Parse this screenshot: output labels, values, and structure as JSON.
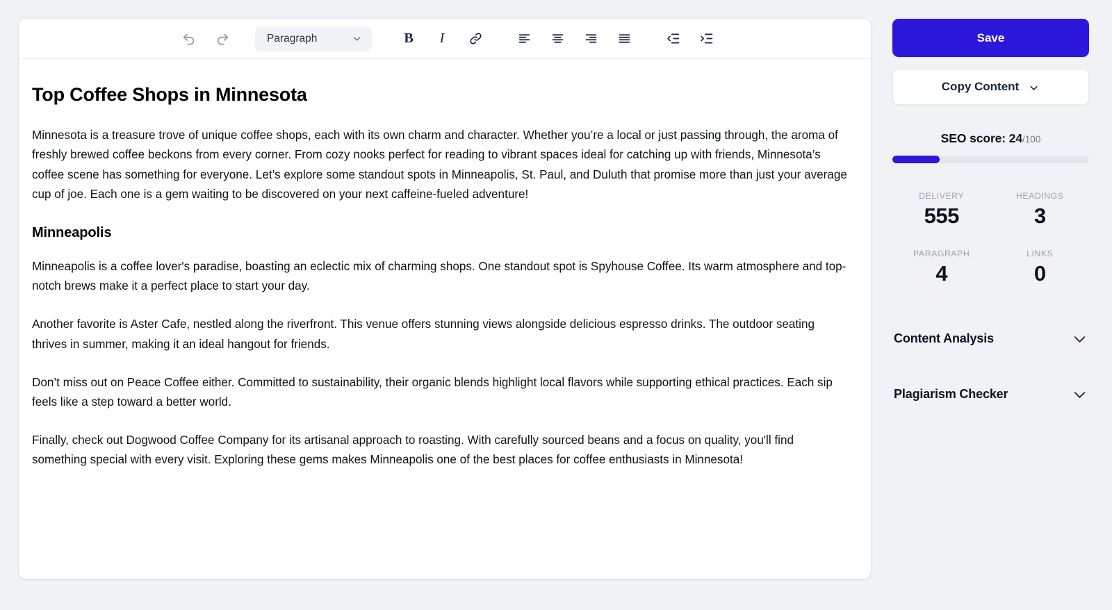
{
  "toolbar": {
    "undo_label": "Undo",
    "redo_label": "Redo",
    "block_format": "Paragraph",
    "bold_label": "B",
    "italic_label": "I",
    "link_label": "Link",
    "align_left_label": "Align left",
    "align_center_label": "Align center",
    "align_right_label": "Align right",
    "align_justify_label": "Justify",
    "outdent_label": "Decrease indent",
    "indent_label": "Increase indent"
  },
  "document": {
    "title": "Top Coffee Shops in Minnesota",
    "intro": "Minnesota is a treasure trove of unique coffee shops, each with its own charm and character. Whether you’re a local or just passing through, the aroma of freshly brewed coffee beckons from every corner. From cozy nooks perfect for reading to vibrant spaces ideal for catching up with friends, Minnesota’s coffee scene has something for everyone. Let’s explore some standout spots in Minneapolis, St. Paul, and Duluth that promise more than just your average cup of joe. Each one is a gem waiting to be discovered on your next caffeine-fueled adventure!",
    "section_heading": "Minneapolis",
    "paragraphs": [
      "Minneapolis is a coffee lover's paradise, boasting an eclectic mix of charming shops. One standout spot is Spyhouse Coffee. Its warm atmosphere and top-notch brews make it a perfect place to start your day.",
      "Another favorite is Aster Cafe, nestled along the riverfront. This venue offers stunning views alongside delicious espresso drinks. The outdoor seating thrives in summer, making it an ideal hangout for friends.",
      "Don’t miss out on Peace Coffee either. Committed to sustainability, their organic blends highlight local flavors while supporting ethical practices. Each sip feels like a step toward a better world.",
      "Finally, check out Dogwood Coffee Company for its artisanal approach to roasting. With carefully sourced beans and a focus on quality, you'll find something special with every visit. Exploring these gems makes Minneapolis one of the best places for coffee enthusiasts in Minnesota!"
    ]
  },
  "sidebar": {
    "save_label": "Save",
    "copy_label": "Copy Content",
    "seo": {
      "label": "SEO score: ",
      "score": "24",
      "denominator": "/100",
      "percent": 24
    },
    "stats": [
      {
        "label": "DELIVERY",
        "value": "555"
      },
      {
        "label": "HEADINGS",
        "value": "3"
      },
      {
        "label": "PARAGRAPH",
        "value": "4"
      },
      {
        "label": "LINKS",
        "value": "0"
      }
    ],
    "panels": [
      {
        "title": "Content Analysis"
      },
      {
        "title": "Plagiarism Checker"
      }
    ]
  },
  "colors": {
    "accent": "#2d17db",
    "page_background": "#f1f2f5",
    "card_background": "#ffffff",
    "toolbar_icon": "#94a1b2",
    "toolbar_icon_dark": "#16263d",
    "progress_track": "#e4e6eb",
    "stat_label": "#9aa1ae"
  }
}
